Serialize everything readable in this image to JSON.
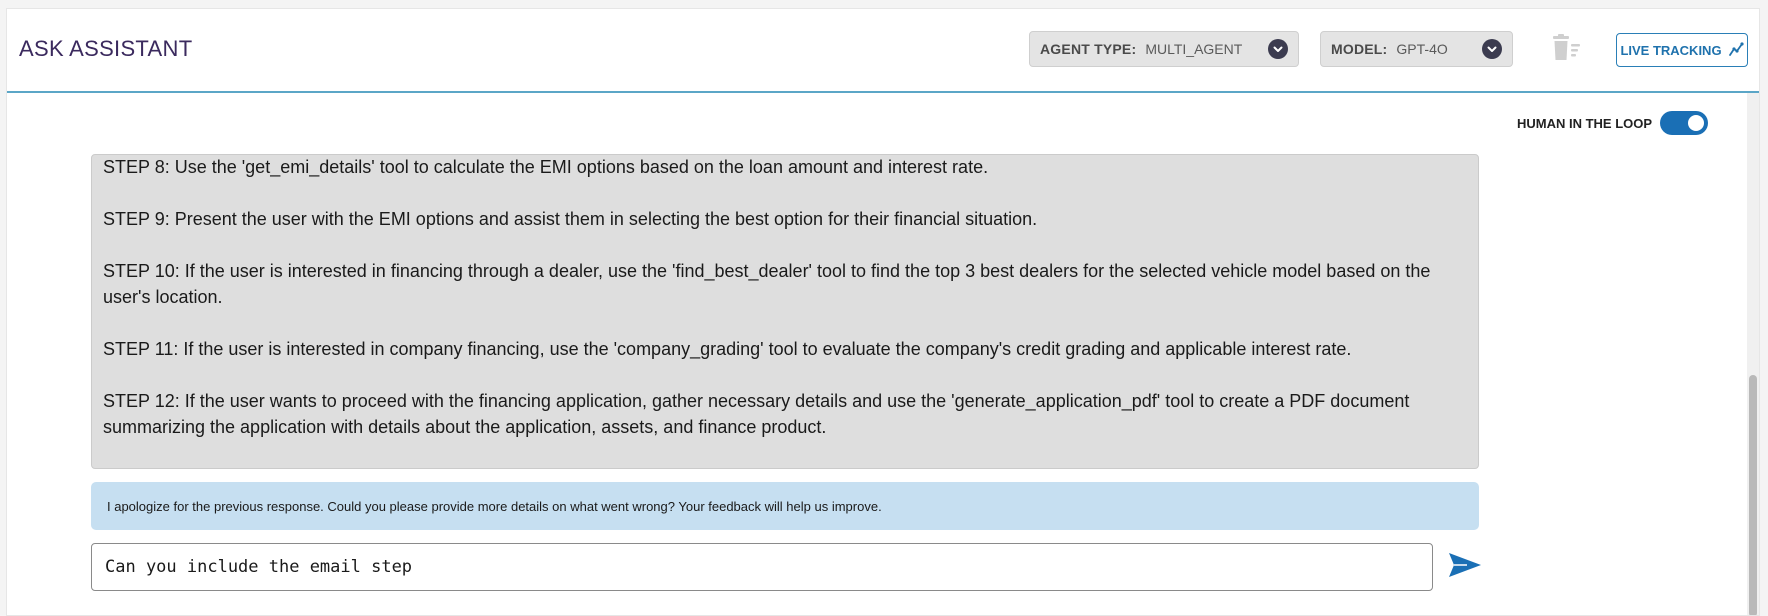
{
  "header": {
    "title": "ASK ASSISTANT",
    "agent_type": {
      "label": "AGENT TYPE:",
      "value": "MULTI_AGENT"
    },
    "model": {
      "label": "MODEL:",
      "value": "GPT-4O"
    },
    "live_tracking_label": "LIVE TRACKING"
  },
  "human_in_the_loop": {
    "label": "HUMAN IN THE LOOP",
    "enabled": true
  },
  "assistant_message": {
    "steps": [
      "STEP 8: Use the 'get_emi_details' tool to calculate the EMI options based on the loan amount and interest rate.",
      "STEP 9: Present the user with the EMI options and assist them in selecting the best option for their financial situation.",
      "STEP 10: If the user is interested in financing through a dealer, use the 'find_best_dealer' tool to find the top 3 best dealers for the selected vehicle model based on the user's location.",
      "STEP 11: If the user is interested in company financing, use the 'company_grading' tool to evaluate the company's credit grading and applicable interest rate.",
      "STEP 12: If the user wants to proceed with the financing application, gather necessary details and use the 'generate_application_pdf' tool to create a PDF document summarizing the application with details about the application, assets, and finance product."
    ]
  },
  "feedback_message": "I apologize for the previous response. Could you please provide more details on what went wrong? Your feedback will help us improve.",
  "chat_input": {
    "value": "Can you include the email step "
  },
  "colors": {
    "title": "#3b2a5e",
    "accent_blue": "#1a6fb5",
    "feedback_bg": "#c6dff1",
    "message_bg": "#dedede"
  },
  "icons": [
    "chevron-down-icon",
    "trash-icon",
    "chart-line-icon",
    "send-icon"
  ]
}
